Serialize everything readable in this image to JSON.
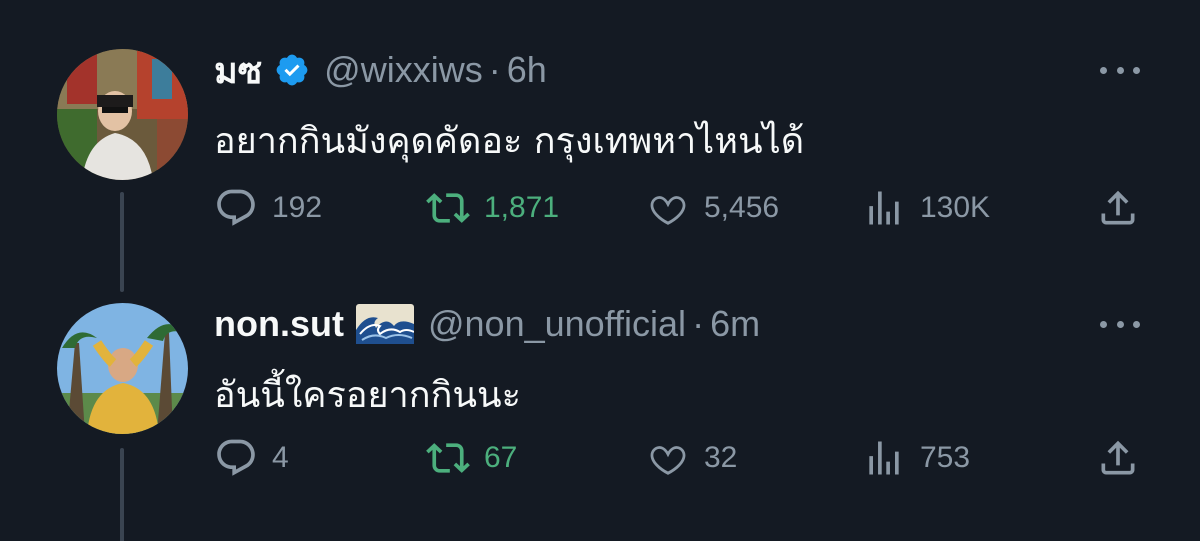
{
  "tweets": [
    {
      "display_name": "มซ",
      "verified": true,
      "handle": "@wixxiws",
      "separator": "·",
      "time": "6h",
      "text": "อยากกินมังคุดคัดอะ กรุงเทพหาไหนได้",
      "replies": "192",
      "retweets": "1,871",
      "likes": "5,456",
      "views": "130K"
    },
    {
      "display_name": "non.sut",
      "emoji": "wave-emoji",
      "handle": "@non_unofficial",
      "separator": "·",
      "time": "6m",
      "text": "อันนี้ใครอยากกินนะ",
      "replies": "4",
      "retweets": "67",
      "likes": "32",
      "views": "753"
    }
  ],
  "colors": {
    "background": "#141a23",
    "text": "#f7f9f9",
    "muted": "#8b98a5",
    "retweet_active": "#4caf7d",
    "verified": "#1d9bf0",
    "thread_line": "#3a4451"
  }
}
